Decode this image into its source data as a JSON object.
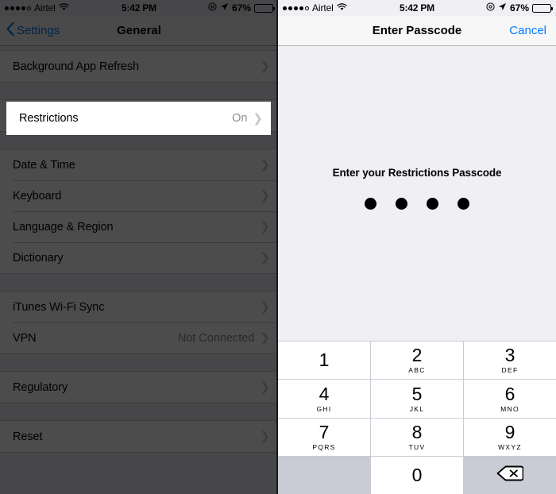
{
  "status_bar": {
    "signal_dots_filled": 4,
    "signal_dots_total": 5,
    "carrier": "Airtel",
    "wifi_icon": "wifi-icon",
    "time": "5:42 PM",
    "alarm_icon": "alarm-clock-icon",
    "location_icon": "location-arrow-icon",
    "battery_percent": "67%",
    "battery_level": 67
  },
  "left_panel": {
    "nav": {
      "back_label": "Settings",
      "back_icon": "chevron-left-icon",
      "title": "General"
    },
    "groups": [
      {
        "rows": [
          {
            "label": "Background App Refresh",
            "value": "",
            "accessory": "chevron-right-icon"
          }
        ]
      },
      {
        "rows": [
          {
            "label": "Restrictions",
            "value": "On",
            "accessory": "chevron-right-icon"
          }
        ]
      },
      {
        "rows": [
          {
            "label": "Date & Time",
            "value": "",
            "accessory": "chevron-right-icon"
          },
          {
            "label": "Keyboard",
            "value": "",
            "accessory": "chevron-right-icon"
          },
          {
            "label": "Language & Region",
            "value": "",
            "accessory": "chevron-right-icon"
          },
          {
            "label": "Dictionary",
            "value": "",
            "accessory": "chevron-right-icon"
          }
        ]
      },
      {
        "rows": [
          {
            "label": "iTunes Wi-Fi Sync",
            "value": "",
            "accessory": "chevron-right-icon"
          },
          {
            "label": "VPN",
            "value": "Not Connected",
            "accessory": "chevron-right-icon"
          }
        ]
      },
      {
        "rows": [
          {
            "label": "Regulatory",
            "value": "",
            "accessory": "chevron-right-icon"
          }
        ]
      },
      {
        "rows": [
          {
            "label": "Reset",
            "value": "",
            "accessory": "chevron-right-icon"
          }
        ]
      }
    ],
    "highlight": {
      "label": "Restrictions",
      "value": "On",
      "accessory": "chevron-right-icon"
    }
  },
  "right_panel": {
    "nav": {
      "title": "Enter Passcode",
      "cancel_label": "Cancel"
    },
    "prompt": "Enter your Restrictions Passcode",
    "passcode_dots": 4,
    "passcode_dots_filled": 4,
    "keypad": [
      {
        "digit": "1",
        "letters": ""
      },
      {
        "digit": "2",
        "letters": "ABC"
      },
      {
        "digit": "3",
        "letters": "DEF"
      },
      {
        "digit": "4",
        "letters": "GHI"
      },
      {
        "digit": "5",
        "letters": "JKL"
      },
      {
        "digit": "6",
        "letters": "MNO"
      },
      {
        "digit": "7",
        "letters": "PQRS"
      },
      {
        "digit": "8",
        "letters": "TUV"
      },
      {
        "digit": "9",
        "letters": "WXYZ"
      },
      {
        "digit": "",
        "letters": "",
        "type": "blank"
      },
      {
        "digit": "0",
        "letters": ""
      },
      {
        "digit": "",
        "letters": "",
        "type": "delete",
        "icon": "backspace-icon"
      }
    ]
  },
  "colors": {
    "accent_blue": "#007aff",
    "keypad_bg": "#c9ccd4",
    "panel_bg": "#efeff4",
    "dim_overlay": "rgba(0,0,0,0.70)"
  }
}
